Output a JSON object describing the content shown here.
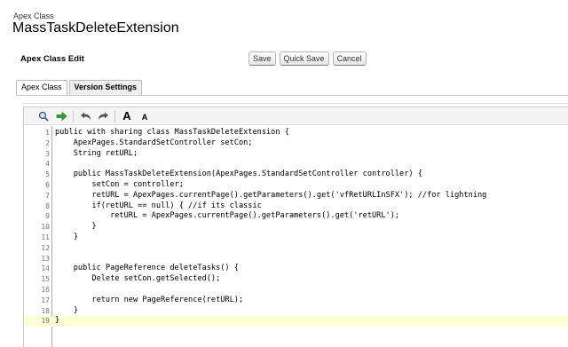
{
  "header": {
    "breadcrumb": "Apex Class",
    "title": "MassTaskDeleteExtension"
  },
  "edit_section": {
    "title": "Apex Class Edit",
    "buttons": {
      "save": "Save",
      "quick_save": "Quick Save",
      "cancel": "Cancel"
    }
  },
  "tabs": [
    {
      "label": "Apex Class"
    },
    {
      "label": "Version Settings"
    }
  ],
  "toolbar": {
    "icons": [
      "search-icon",
      "goto-arrow-icon",
      "undo-icon",
      "redo-icon",
      "font-increase-icon",
      "font-decrease-icon"
    ],
    "font_large": "A",
    "font_small": "A"
  },
  "code": {
    "highlighted_line": 19,
    "lines": [
      "public with sharing class MassTaskDeleteExtension {",
      "    ApexPages.StandardSetController setCon;",
      "    String retURL;",
      "",
      "    public MassTaskDeleteExtension(ApexPages.StandardSetController controller) {",
      "        setCon = controller;",
      "        retURL = ApexPages.currentPage().getParameters().get('vfRetURLInSFX'); //for lightning",
      "        if(retURL == null) { //if its classic",
      "            retURL = ApexPages.currentPage().getParameters().get('retURL');",
      "        }",
      "    }",
      "",
      "",
      "    public PageReference deleteTasks() {",
      "        Delete setCon.getSelected();",
      "",
      "        return new PageReference(retURL);",
      "    }",
      "}"
    ]
  }
}
